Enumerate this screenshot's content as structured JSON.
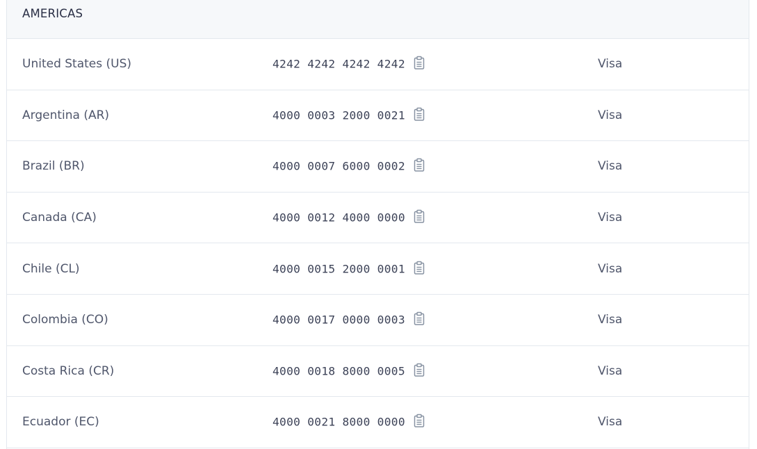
{
  "section": {
    "title": "AMERICAS"
  },
  "rows": [
    {
      "country": "United States (US)",
      "number": "4242 4242 4242 4242",
      "brand": "Visa"
    },
    {
      "country": "Argentina (AR)",
      "number": "4000 0003 2000 0021",
      "brand": "Visa"
    },
    {
      "country": "Brazil (BR)",
      "number": "4000 0007 6000 0002",
      "brand": "Visa"
    },
    {
      "country": "Canada (CA)",
      "number": "4000 0012 4000 0000",
      "brand": "Visa"
    },
    {
      "country": "Chile (CL)",
      "number": "4000 0015 2000 0001",
      "brand": "Visa"
    },
    {
      "country": "Colombia (CO)",
      "number": "4000 0017 0000 0003",
      "brand": "Visa"
    },
    {
      "country": "Costa Rica (CR)",
      "number": "4000 0018 8000 0005",
      "brand": "Visa"
    },
    {
      "country": "Ecuador (EC)",
      "number": "4000 0021 8000 0000",
      "brand": "Visa"
    }
  ],
  "icons": {
    "copy": "clipboard-icon"
  },
  "colors": {
    "header_bg": "#f6f8fa",
    "border": "#e3e8ee",
    "text": "#4f566b",
    "icon": "#8792a2"
  }
}
